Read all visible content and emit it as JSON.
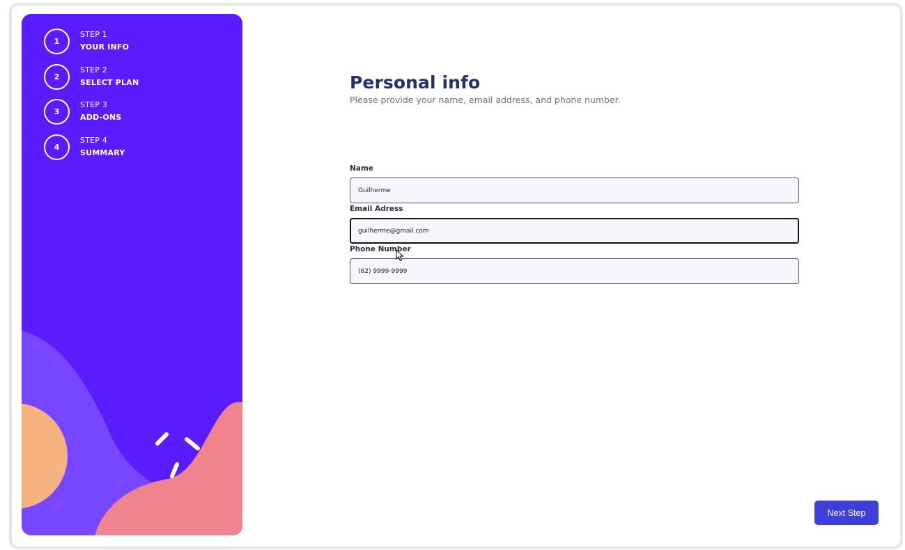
{
  "sidebar": {
    "steps": [
      {
        "number": "1",
        "label": "STEP 1",
        "name": "YOUR INFO"
      },
      {
        "number": "2",
        "label": "STEP 2",
        "name": "SELECT PLAN"
      },
      {
        "number": "3",
        "label": "STEP 3",
        "name": "ADD-ONS"
      },
      {
        "number": "4",
        "label": "STEP 4",
        "name": "SUMMARY"
      }
    ],
    "colors": {
      "background": "#5b1cfd",
      "wave_light": "#7647ff",
      "wave_pink": "#ef848e",
      "circle_orange": "#f6b27f"
    }
  },
  "main": {
    "title": "Personal info",
    "subtitle": "Please provide your name, email address, and phone number.",
    "fields": {
      "name": {
        "label": "Name",
        "value": "Guilherme"
      },
      "email": {
        "label": "Email Adress",
        "value": "guilherme@gmail.com"
      },
      "phone": {
        "label": "Phone Number",
        "value": "(62) 9999-9999"
      }
    },
    "next_label": "Next Step"
  },
  "icons": {
    "cursor": "mouse-pointer-icon"
  }
}
